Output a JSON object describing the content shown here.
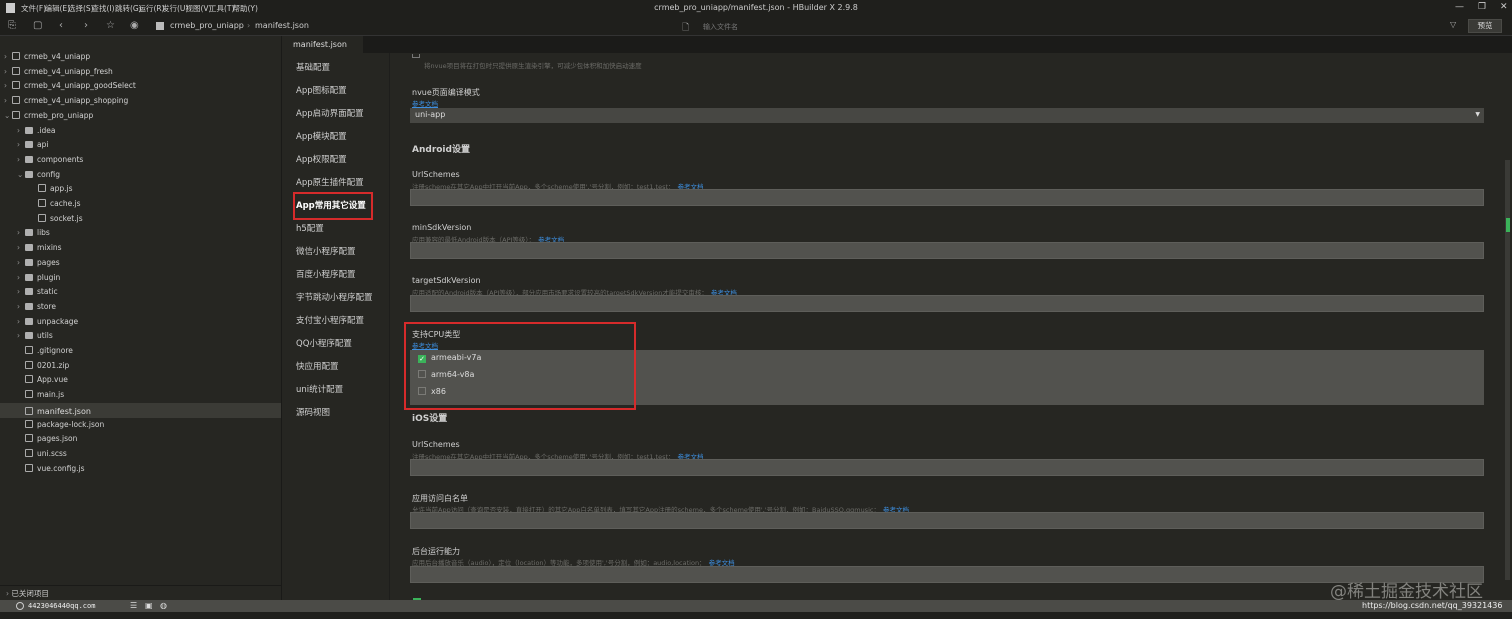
{
  "menu": [
    "文件(F)",
    "编辑(E)",
    "选择(S)",
    "查找(I)",
    "跳转(G)",
    "运行(R)",
    "发行(U)",
    "视图(V)",
    "工具(T)",
    "帮助(Y)"
  ],
  "window_title": "crmeb_pro_uniapp/manifest.json - HBuilder X 2.9.8",
  "breadcrumb": [
    "crmeb_pro_uniapp",
    "manifest.json"
  ],
  "file_search_placeholder": "输入文件名",
  "preview_label": "预览",
  "tree": [
    {
      "label": "crmeb_v4_uniapp",
      "depth": 0,
      "type": "project"
    },
    {
      "label": "crmeb_v4_uniapp_fresh",
      "depth": 0,
      "type": "project"
    },
    {
      "label": "crmeb_v4_uniapp_goodSelect",
      "depth": 0,
      "type": "project"
    },
    {
      "label": "crmeb_v4_uniapp_shopping",
      "depth": 0,
      "type": "project"
    },
    {
      "label": "crmeb_pro_uniapp",
      "depth": 0,
      "type": "project",
      "open": true
    },
    {
      "label": ".idea",
      "depth": 1,
      "type": "folder"
    },
    {
      "label": "api",
      "depth": 1,
      "type": "folder"
    },
    {
      "label": "components",
      "depth": 1,
      "type": "folder"
    },
    {
      "label": "config",
      "depth": 1,
      "type": "folder",
      "open": true
    },
    {
      "label": "app.js",
      "depth": 2,
      "type": "file"
    },
    {
      "label": "cache.js",
      "depth": 2,
      "type": "file"
    },
    {
      "label": "socket.js",
      "depth": 2,
      "type": "file"
    },
    {
      "label": "libs",
      "depth": 1,
      "type": "folder"
    },
    {
      "label": "mixins",
      "depth": 1,
      "type": "folder"
    },
    {
      "label": "pages",
      "depth": 1,
      "type": "folder"
    },
    {
      "label": "plugin",
      "depth": 1,
      "type": "folder"
    },
    {
      "label": "static",
      "depth": 1,
      "type": "folder"
    },
    {
      "label": "store",
      "depth": 1,
      "type": "folder"
    },
    {
      "label": "unpackage",
      "depth": 1,
      "type": "folder"
    },
    {
      "label": "utils",
      "depth": 1,
      "type": "folder"
    },
    {
      "label": ".gitignore",
      "depth": 1,
      "type": "file"
    },
    {
      "label": "0201.zip",
      "depth": 1,
      "type": "file"
    },
    {
      "label": "App.vue",
      "depth": 1,
      "type": "file"
    },
    {
      "label": "main.js",
      "depth": 1,
      "type": "file"
    },
    {
      "label": "manifest.json",
      "depth": 1,
      "type": "file",
      "selected": true
    },
    {
      "label": "package-lock.json",
      "depth": 1,
      "type": "file"
    },
    {
      "label": "pages.json",
      "depth": 1,
      "type": "file"
    },
    {
      "label": "uni.scss",
      "depth": 1,
      "type": "file"
    },
    {
      "label": "vue.config.js",
      "depth": 1,
      "type": "file"
    }
  ],
  "closed_projects": "已关闭项目",
  "tab": "manifest.json",
  "nav": [
    "基础配置",
    "App图标配置",
    "App启动界面配置",
    "App模块配置",
    "App权限配置",
    "App原生插件配置",
    "App常用其它设置",
    "h5配置",
    "微信小程序配置",
    "百度小程序配置",
    "字节跳动小程序配置",
    "支付宝小程序配置",
    "QQ小程序配置",
    "快应用配置",
    "uni统计配置",
    "源码视图"
  ],
  "content": {
    "nvue_desc": "将nvue项目将在打包时只提供原生渲染引擎，可减少包体积和加快启动速度",
    "ref": "参考文档",
    "nvue_mode_label": "nvue页面编译模式",
    "nvue_mode_value": "uni-app",
    "android_title": "Android设置",
    "a_url_label": "UrlSchemes",
    "a_url_desc": "注册scheme在其它App中打开当前App，多个scheme使用','号分割，例如：test1,test：",
    "min_label": "minSdkVersion",
    "min_desc": "应用兼容的最低Android版本（API等级）：",
    "target_label": "targetSdkVersion",
    "target_desc": "应用适配的Android版本（API等级），部分应用市场要求设置较高的targetSdkVersion才能提交审核：",
    "cpu_label": "支持CPU类型",
    "cpu": [
      {
        "label": "armeabi-v7a",
        "checked": true
      },
      {
        "label": "arm64-v8a",
        "checked": false
      },
      {
        "label": "x86",
        "checked": false
      }
    ],
    "ios_title": "iOS设置",
    "i_url_label": "UrlSchemes",
    "i_url_desc": "注册scheme在其它App中打开当前App，多个scheme使用','号分割，例如：test1,test：",
    "white_label": "应用访问白名单",
    "white_desc": "允许当前App访问（查询是否安装，直接打开）的其它App白名单列表，填写其它App注册的scheme，多个scheme使用','号分割，例如：BaiduSSO,qqmusic：",
    "bg_label": "后台运行能力",
    "bg_desc": "应用后台播放音乐（audio），定位（location）等功能，多项使用','号分割，例如：audio,location："
  },
  "status": {
    "user": "4423046440qq.com"
  },
  "watermark": "@稀土掘金技术社区",
  "url_overlay": "https://blog.csdn.net/qq_39321436"
}
